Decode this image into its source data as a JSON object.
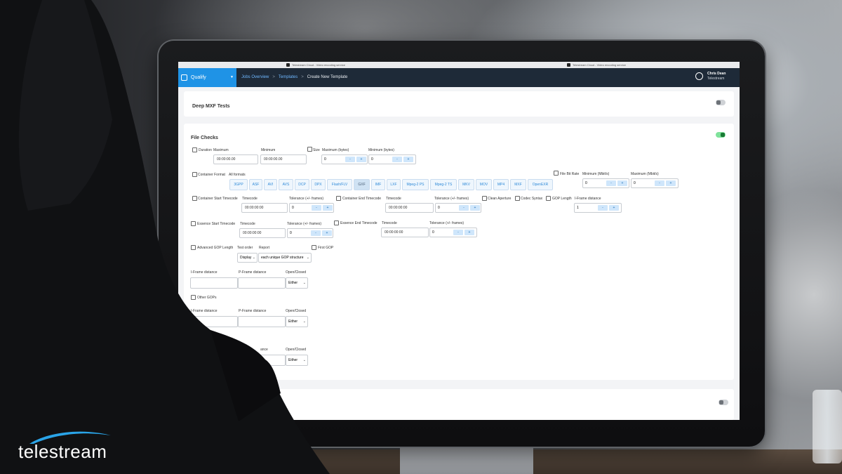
{
  "browser": {
    "tab1": "Telestream Cloud - Video encoding service",
    "tab2": "Telestream Cloud - Video encoding service"
  },
  "topbar": {
    "product": "Qualify",
    "breadcrumb": [
      "Jobs Overview",
      "Templates",
      "Create New Template"
    ],
    "user_name": "Chris Dean",
    "user_org": "Telestream"
  },
  "deep_mxf": {
    "title": "Deep MXF Tests",
    "enabled": false
  },
  "file_checks": {
    "title": "File Checks",
    "enabled": true,
    "duration": {
      "label": "Duration",
      "max_label": "Maximum",
      "min_label": "Minimum",
      "max": "00:00:00.00",
      "min": "00:00:00.00"
    },
    "size": {
      "label": "Size",
      "max_label": "Maximum (bytes)",
      "min_label": "Minimum (bytes)",
      "max": "0",
      "min": "0"
    },
    "container_format": {
      "label": "Container Format",
      "all_label": "All formats",
      "formats": [
        "3GPP",
        "ASF",
        "AVI",
        "AVS",
        "DCP",
        "DPX",
        "Flash/FLV",
        "GXF",
        "IMF",
        "LXF",
        "Mpeg-2 PS",
        "Mpeg-2 TS",
        "MKV",
        "MOV",
        "MP4",
        "MXF",
        "OpenEXR"
      ],
      "selected": "GXF"
    },
    "file_bit_rate": {
      "label": "File Bit Rate",
      "min_label": "Minimum (Mbit/s)",
      "max_label": "Maximum (Mbit/s)",
      "min": "0",
      "max": "0"
    },
    "container_start_tc": {
      "label": "Container Start Timecode",
      "tc_label": "Timecode",
      "tol_label": "Tolerance (+/- frames)",
      "tc": "00:00:00:00",
      "tol": "0"
    },
    "container_end_tc": {
      "label": "Container End Timecode",
      "tc_label": "Timecode",
      "tol_label": "Tolerance (+/- frames)",
      "tc": "00:00:00:00",
      "tol": "0"
    },
    "clean_aperture": "Clean Aperture",
    "codec_syntax": "Codec Syntax",
    "gop_length": {
      "label": "GOP Length",
      "iframe_label": "I-Frame distance",
      "value": "1"
    },
    "essence_start_tc": {
      "label": "Essence Start Timecode",
      "tc_label": "Timecode",
      "tol_label": "Tolerance (+/- frames)",
      "tc": "00:00:00:00",
      "tol": "0"
    },
    "essence_end_tc": {
      "label": "Essence End Timecode",
      "tc_label": "Timecode",
      "tol_label": "Tolerance (+/- frames)",
      "tc": "00:00:00:00",
      "tol": "0"
    },
    "advanced_gop": {
      "label": "Advanced GOP Length",
      "test_order_label": "Test order",
      "report_label": "Report",
      "test_order": "Display",
      "report": "each unique GOP structure",
      "first_gop": "First GOP"
    },
    "gop_row_labels": {
      "iframe": "I-Frame distance",
      "pframe": "P-Frame distance",
      "open_closed": "Open/Closed",
      "either": "Either"
    },
    "other_gops": "Other GOPs",
    "partial_label": "GOPs",
    "partial_ance": "ance"
  },
  "brand": {
    "logo_text": "telestream",
    "accent": "#1f93e6"
  }
}
